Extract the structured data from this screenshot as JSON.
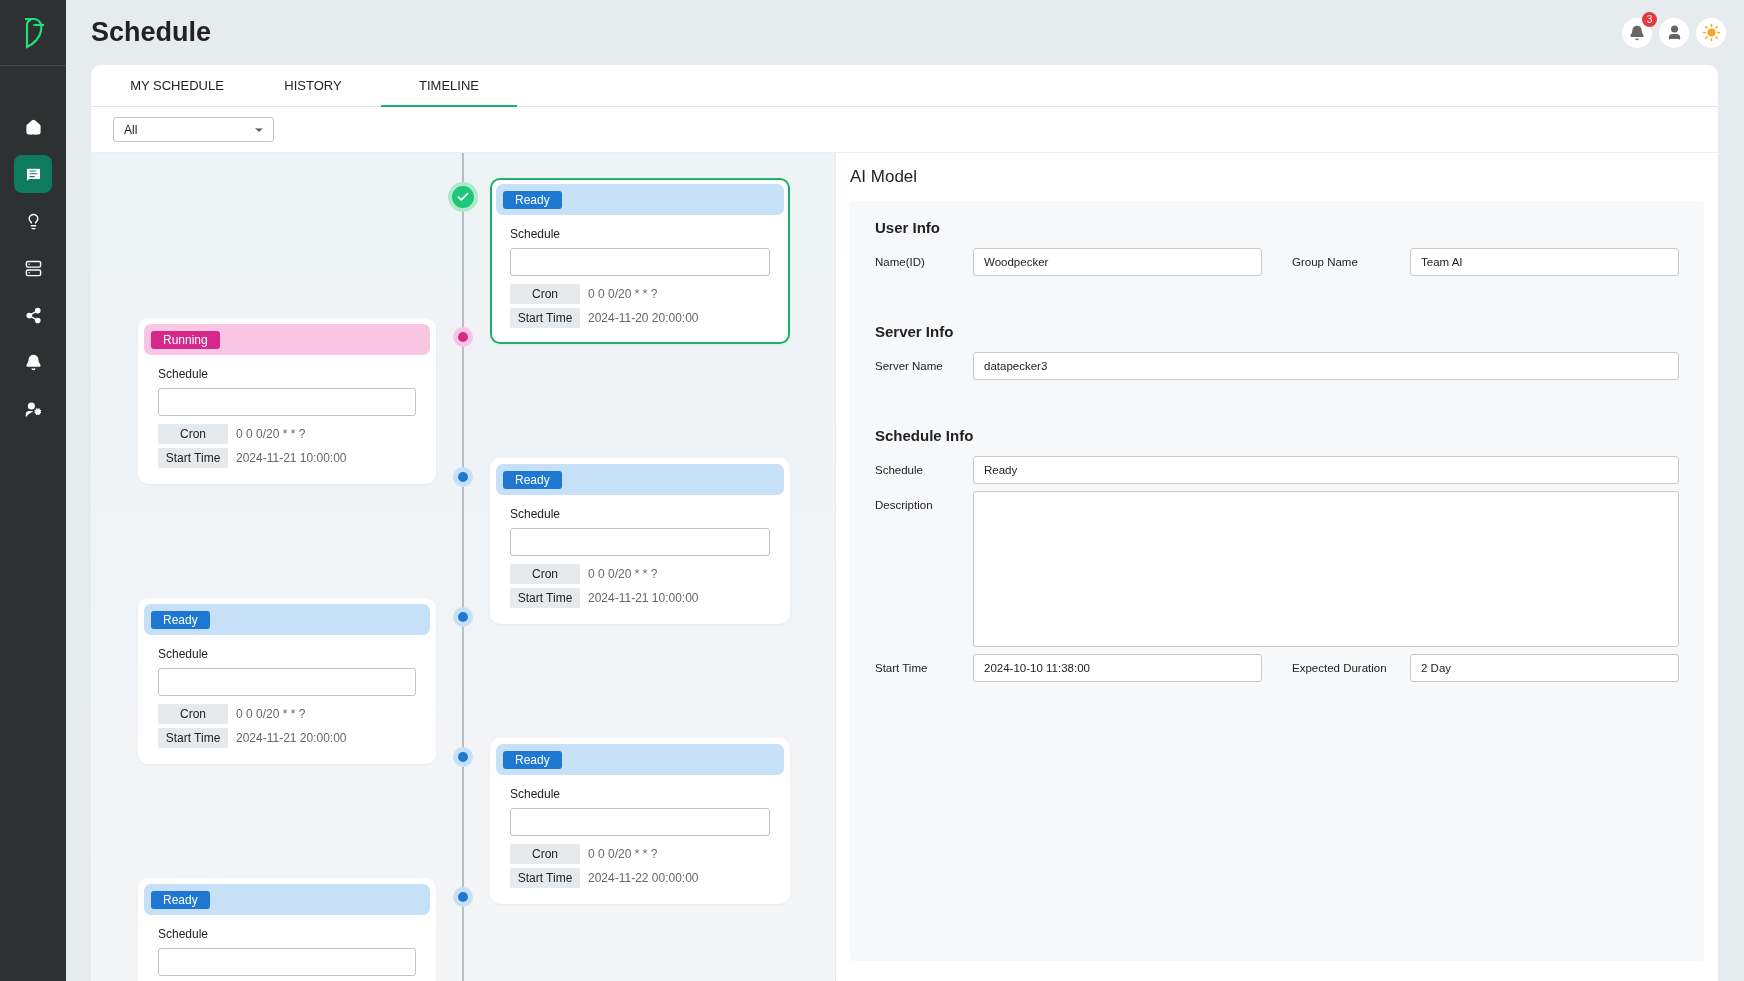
{
  "header": {
    "title": "Schedule",
    "notifications": "3"
  },
  "sidebar": {
    "items": [
      {
        "selected": false
      },
      {
        "selected": true
      },
      {
        "selected": false
      },
      {
        "selected": false
      },
      {
        "selected": false
      },
      {
        "selected": false
      },
      {
        "selected": false
      }
    ]
  },
  "tabs": [
    {
      "label": "MY SCHEDULE",
      "selected": false
    },
    {
      "label": "HISTORY",
      "selected": false
    },
    {
      "label": "TIMELINE",
      "selected": true
    }
  ],
  "filter": {
    "value": "All"
  },
  "timeline": {
    "items": [
      {
        "status": "Ready",
        "kind": "ready",
        "selected": true,
        "schedule_label": "Schedule",
        "cron_label": "Cron",
        "cron": "0 0 0/20 * * ?",
        "start_label": "Start Time",
        "start_time": "2024-11-20 20:00:00"
      },
      {
        "status": "Running",
        "kind": "running",
        "selected": false,
        "schedule_label": "Schedule",
        "cron_label": "Cron",
        "cron": "0 0 0/20 * * ?",
        "start_label": "Start Time",
        "start_time": "2024-11-21 10:00:00"
      },
      {
        "status": "Ready",
        "kind": "ready",
        "selected": false,
        "schedule_label": "Schedule",
        "cron_label": "Cron",
        "cron": "0 0 0/20 * * ?",
        "start_label": "Start Time",
        "start_time": "2024-11-21 10:00:00"
      },
      {
        "status": "Ready",
        "kind": "ready",
        "selected": false,
        "schedule_label": "Schedule",
        "cron_label": "Cron",
        "cron": "0 0 0/20 * * ?",
        "start_label": "Start Time",
        "start_time": "2024-11-21 20:00:00"
      },
      {
        "status": "Ready",
        "kind": "ready",
        "selected": false,
        "schedule_label": "Schedule",
        "cron_label": "Cron",
        "cron": "0 0 0/20 * * ?",
        "start_label": "Start Time",
        "start_time": "2024-11-22 00:00:00"
      },
      {
        "status": "Ready",
        "kind": "ready",
        "selected": false,
        "schedule_label": "Schedule"
      }
    ]
  },
  "detail": {
    "title": "AI Model",
    "sections": [
      {
        "title": "User Info",
        "rows": [
          [
            {
              "label": "Name(ID)",
              "value": "Woodpecker",
              "kind": "input"
            },
            {
              "label": "Group Name",
              "value": "Team AI",
              "kind": "input"
            }
          ]
        ]
      },
      {
        "title": "Server Info",
        "rows": [
          [
            {
              "label": "Server Name",
              "value": "datapecker3",
              "kind": "input"
            }
          ]
        ]
      },
      {
        "title": "Schedule Info",
        "rows": [
          [
            {
              "label": "Schedule",
              "value": "Ready",
              "kind": "input"
            }
          ],
          [
            {
              "label": "Description",
              "kind": "textarea"
            }
          ],
          [
            {
              "label": "Start Time",
              "value": "2024-10-10 11:38:00",
              "kind": "input"
            },
            {
              "label": "Expected Duration",
              "value": "2 Day",
              "kind": "input"
            }
          ]
        ]
      }
    ]
  }
}
